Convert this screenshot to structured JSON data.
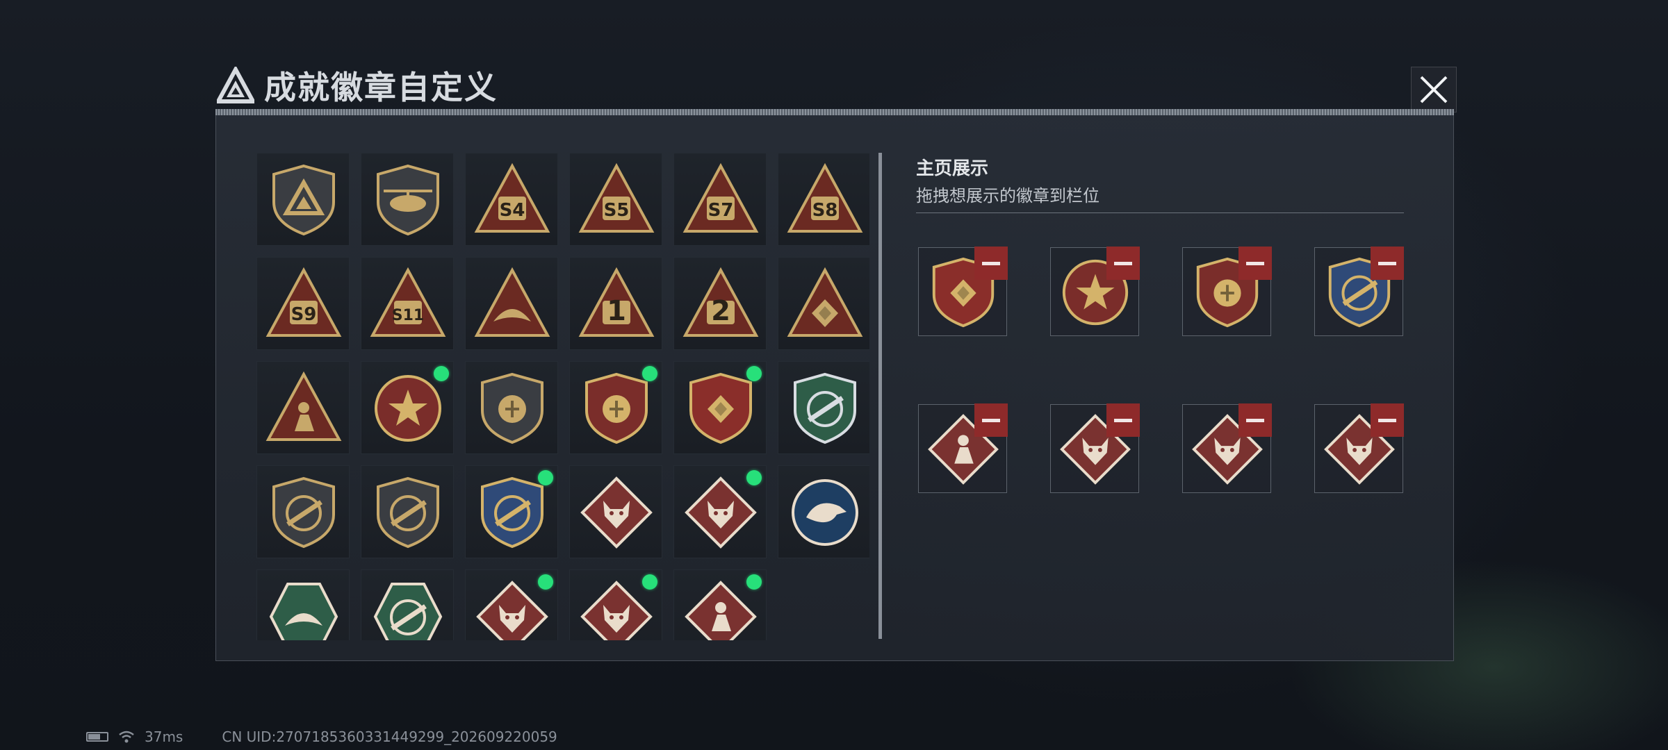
{
  "window": {
    "title": "成就徽章自定义"
  },
  "side": {
    "title": "主页展示",
    "subtitle": "拖拽想展示的徽章到栏位"
  },
  "grid": {
    "badges": [
      {
        "name": "triangle-logo-badge",
        "glyph": "logo",
        "color": "#c7a86a",
        "bg": "#3a3d42",
        "shape": "shield",
        "new": false
      },
      {
        "name": "helicopter-badge",
        "glyph": "heli",
        "color": "#c7a86a",
        "bg": "#3a3d42",
        "shape": "shield",
        "new": false
      },
      {
        "name": "s4-season-badge",
        "text": "S4",
        "color": "#c7a86a",
        "bg": "#6b2a22",
        "shape": "triangle",
        "new": false
      },
      {
        "name": "s5-season-badge",
        "text": "S5",
        "color": "#c7a86a",
        "bg": "#6b2a22",
        "shape": "triangle",
        "new": false
      },
      {
        "name": "s7-season-badge",
        "text": "S7",
        "color": "#c7a86a",
        "bg": "#6b2a22",
        "shape": "triangle",
        "new": false
      },
      {
        "name": "s8-season-badge",
        "text": "S8",
        "color": "#c7a86a",
        "bg": "#6b2a22",
        "shape": "triangle",
        "new": false
      },
      {
        "name": "s9-season-badge",
        "text": "S9",
        "color": "#c7a86a",
        "bg": "#6b2a22",
        "shape": "triangle",
        "new": false
      },
      {
        "name": "s11-season-badge",
        "text": "S11",
        "color": "#c7a86a",
        "bg": "#6b2a22",
        "shape": "triangle",
        "new": false
      },
      {
        "name": "wing-triangle-badge",
        "glyph": "wing",
        "color": "#c7a86a",
        "bg": "#6b2a22",
        "shape": "triangle",
        "new": false
      },
      {
        "name": "rank-1-badge",
        "text": "1",
        "color": "#c7a86a",
        "bg": "#6b2a22",
        "shape": "triangle",
        "new": false
      },
      {
        "name": "rank-2-badge",
        "text": "2",
        "color": "#c7a86a",
        "bg": "#6b2a22",
        "shape": "triangle",
        "new": false
      },
      {
        "name": "hands-triangle-badge",
        "glyph": "diamond",
        "color": "#c7a86a",
        "bg": "#6b2a22",
        "shape": "triangle",
        "new": false
      },
      {
        "name": "soldiers-triangle-badge",
        "glyph": "soldier",
        "color": "#c7a86a",
        "bg": "#6b2a22",
        "shape": "triangle",
        "new": false
      },
      {
        "name": "star-medal-badge",
        "glyph": "star",
        "color": "#d4b36a",
        "bg": "#7a2d2a",
        "shape": "circle",
        "new": true
      },
      {
        "name": "plain-shield-badge",
        "glyph": "emblem",
        "color": "#c7a86a",
        "bg": "#3a3d42",
        "shape": "shield",
        "new": false
      },
      {
        "name": "gold-emblem-shield-badge",
        "glyph": "emblem",
        "color": "#d4b36a",
        "bg": "#7a2d2a",
        "shape": "shield",
        "new": true
      },
      {
        "name": "gem-shield-badge",
        "glyph": "diamond",
        "color": "#d4b36a",
        "bg": "#8a2e2a",
        "shape": "shield",
        "new": true
      },
      {
        "name": "rifle-green-shield-badge",
        "glyph": "rifle",
        "color": "#d8dde2",
        "bg": "#2e5d48",
        "shape": "shield",
        "new": false
      },
      {
        "name": "pistol-shield-badge",
        "glyph": "rifle",
        "color": "#c7a86a",
        "bg": "#3a3d42",
        "shape": "shield",
        "new": false
      },
      {
        "name": "knife-shield-badge",
        "glyph": "rifle",
        "color": "#c7a86a",
        "bg": "#3a3d42",
        "shape": "shield",
        "new": false
      },
      {
        "name": "crossed-rifle-shield-badge",
        "glyph": "rifle",
        "color": "#d4b36a",
        "bg": "#2f4a78",
        "shape": "shield",
        "new": true
      },
      {
        "name": "wolf-diamond-badge",
        "glyph": "beast",
        "color": "#e9dccb",
        "bg": "#7a3230",
        "shape": "diamond",
        "new": false
      },
      {
        "name": "wolf-diamond-badge-2",
        "glyph": "beast",
        "color": "#e9dccb",
        "bg": "#7a3230",
        "shape": "diamond",
        "new": true
      },
      {
        "name": "eagle-circle-badge",
        "glyph": "eagle",
        "color": "#e9dccb",
        "bg": "#1e3e62",
        "shape": "circle",
        "new": false
      },
      {
        "name": "wasp-hexagon-badge",
        "glyph": "wing",
        "color": "#e9dccb",
        "bg": "#2e5d48",
        "shape": "hexagon",
        "new": false
      },
      {
        "name": "gun-hexagon-badge",
        "glyph": "rifle",
        "color": "#e9dccb",
        "bg": "#2e5d48",
        "shape": "hexagon",
        "new": false
      },
      {
        "name": "dragon-diamond-badge",
        "glyph": "beast",
        "color": "#e9dccb",
        "bg": "#7a3230",
        "shape": "diamond",
        "new": true
      },
      {
        "name": "dragon-diamond-badge-2",
        "glyph": "beast",
        "color": "#e9dccb",
        "bg": "#7a3230",
        "shape": "diamond",
        "new": true
      },
      {
        "name": "runner-diamond-badge",
        "glyph": "soldier",
        "color": "#e9dccb",
        "bg": "#7a3230",
        "shape": "diamond",
        "new": true
      }
    ]
  },
  "slots": [
    {
      "name": "slot-gem-shield",
      "glyph": "diamond",
      "color": "#d4b36a",
      "bg": "#8a2e2a",
      "shape": "shield"
    },
    {
      "name": "slot-star-medal",
      "glyph": "star",
      "color": "#d4b36a",
      "bg": "#7a2d2a",
      "shape": "circle"
    },
    {
      "name": "slot-gold-emblem-shield",
      "glyph": "emblem",
      "color": "#d4b36a",
      "bg": "#7a2d2a",
      "shape": "shield"
    },
    {
      "name": "slot-crossed-rifle-shield",
      "glyph": "rifle",
      "color": "#d4b36a",
      "bg": "#2f4a78",
      "shape": "shield"
    },
    {
      "name": "slot-runner-diamond",
      "glyph": "soldier",
      "color": "#e9dccb",
      "bg": "#7a3230",
      "shape": "diamond"
    },
    {
      "name": "slot-wolf-diamond",
      "glyph": "beast",
      "color": "#e9dccb",
      "bg": "#7a3230",
      "shape": "diamond"
    },
    {
      "name": "slot-dragon-diamond",
      "glyph": "beast",
      "color": "#e9dccb",
      "bg": "#7a3230",
      "shape": "diamond"
    },
    {
      "name": "slot-dragon-diamond-2",
      "glyph": "beast",
      "color": "#e9dccb",
      "bg": "#7a3230",
      "shape": "diamond"
    }
  ],
  "status": {
    "ping": "37ms",
    "uid": "CN UID:2707185360331449299_202609220059"
  },
  "colors": {
    "accent_gold": "#c7a86a",
    "new_dot": "#27e07a",
    "remove_red": "#8e2a2a"
  }
}
